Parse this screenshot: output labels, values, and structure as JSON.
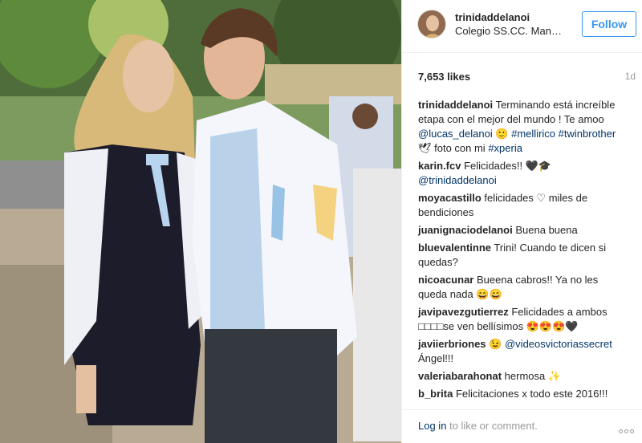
{
  "header": {
    "username": "trinidaddelanoi",
    "location": "Colegio SS.CC. Manquehue",
    "follow_label": "Follow"
  },
  "meta": {
    "likes": "7,653 likes",
    "time_ago": "1d"
  },
  "comments": [
    {
      "user": "trinidaddelanoi",
      "parts": [
        {
          "t": "Terminando está increíble etapa con el mejor del mundo ! Te amoo "
        },
        {
          "t": "@lucas_delanoi",
          "tag": true
        },
        {
          "t": " 🙂 "
        },
        {
          "t": "#mellirico",
          "tag": true
        },
        {
          "t": " "
        },
        {
          "t": "#twinbrother",
          "tag": true
        },
        {
          "t": " 🕊 foto con mi "
        },
        {
          "t": "#xperia",
          "tag": true
        }
      ]
    },
    {
      "user": "karin.fcv",
      "parts": [
        {
          "t": "Felicidades!! 🖤🎓 "
        },
        {
          "t": "@trinidaddelanoi",
          "tag": true
        }
      ]
    },
    {
      "user": "moyacastillo",
      "parts": [
        {
          "t": "felicidades ♡ miles de bendiciones"
        }
      ]
    },
    {
      "user": "juanignaciodelanoi",
      "parts": [
        {
          "t": "Buena buena"
        }
      ]
    },
    {
      "user": "bluevalentinne",
      "parts": [
        {
          "t": "Trini! Cuando te dicen si quedas?"
        }
      ]
    },
    {
      "user": "nicoacunar",
      "parts": [
        {
          "t": "Bueena cabros!! Ya no les queda nada 😄😄"
        }
      ]
    },
    {
      "user": "javipavezgutierrez",
      "parts": [
        {
          "t": "Felicidades a ambos □□□□se ven bellísimos 😍😍😍🖤"
        }
      ]
    },
    {
      "user": "javiierbriones",
      "parts": [
        {
          "t": "😉 "
        },
        {
          "t": "@videosvictoriassecret",
          "tag": true
        },
        {
          "t": " Ángel!!!"
        }
      ]
    },
    {
      "user": "valeriabarahonat",
      "parts": [
        {
          "t": "hermosa ✨"
        }
      ]
    },
    {
      "user": "b_brita",
      "parts": [
        {
          "t": "Felicitaciones x todo este 2016!!!"
        }
      ]
    }
  ],
  "footer": {
    "login_link": "Log in",
    "login_rest": " to like or comment."
  },
  "colors": {
    "accent": "#3897f0",
    "link": "#003569",
    "muted": "#999999"
  }
}
